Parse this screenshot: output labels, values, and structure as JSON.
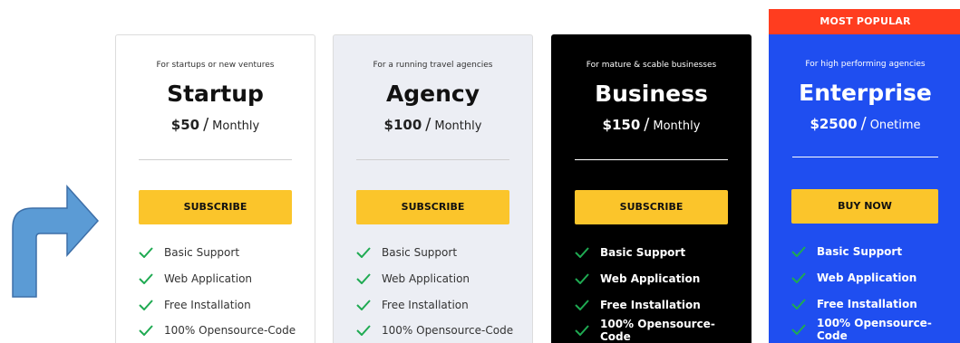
{
  "plans": [
    {
      "tagline": "For startups or new ventures",
      "name": "Startup",
      "price": "$50",
      "separator": "/",
      "period": "Monthly",
      "cta": "SUBSCRIBE",
      "features": [
        "Basic Support",
        "Web Application",
        "Free Installation",
        "100% Opensource-Code"
      ]
    },
    {
      "tagline": "For a running travel agencies",
      "name": "Agency",
      "price": "$100",
      "separator": "/",
      "period": "Monthly",
      "cta": "SUBSCRIBE",
      "features": [
        "Basic Support",
        "Web Application",
        "Free Installation",
        "100% Opensource-Code"
      ]
    },
    {
      "tagline": "For mature & scable businesses",
      "name": "Business",
      "price": "$150",
      "separator": "/",
      "period": "Monthly",
      "cta": "SUBSCRIBE",
      "features": [
        "Basic Support",
        "Web Application",
        "Free Installation",
        "100% Opensource-Code"
      ]
    },
    {
      "badge": "MOST POPULAR",
      "tagline": "For high performing agencies",
      "name": "Enterprise",
      "price": "$2500",
      "separator": "/",
      "period": "Onetime",
      "cta": "BUY NOW",
      "features": [
        "Basic Support",
        "Web Application",
        "Free Installation",
        "100% Opensource-Code"
      ]
    }
  ],
  "icons": {
    "arrow": "curved-arrow-icon",
    "check": "check-icon"
  },
  "colors": {
    "accent_yellow": "#fbc52b",
    "badge_red": "#ff3d1f",
    "enterprise_blue": "#1f4ef0",
    "check_green": "#1faa52",
    "arrow_blue": "#5b9bd5"
  }
}
